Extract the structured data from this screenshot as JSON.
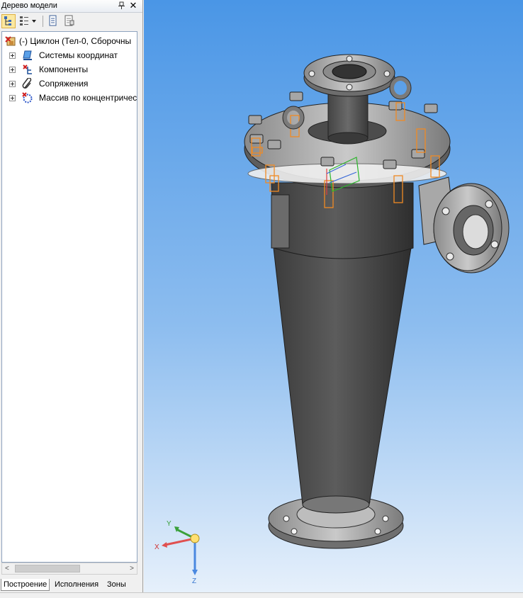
{
  "panel": {
    "title": "Дерево модели",
    "pin": "ᵾ",
    "close": "✕"
  },
  "tree": {
    "root": "(-) Циклон (Тел-0, Сборочны",
    "items": [
      {
        "label": "Системы координат",
        "icon": "coordinate-systems-icon"
      },
      {
        "label": "Компоненты",
        "icon": "components-icon"
      },
      {
        "label": "Сопряжения",
        "icon": "mates-icon"
      },
      {
        "label": "Массив по концентричес",
        "icon": "circular-array-icon"
      }
    ]
  },
  "tabs": [
    "Построение",
    "Исполнения",
    "Зоны"
  ],
  "axes": {
    "x": "X",
    "y": "Y",
    "z": "Z"
  },
  "colors": {
    "viewport_top": "#4a96e6",
    "viewport_bottom": "#e6f0fb",
    "model_body": "#4a4a4a",
    "flange": "#9a9a9a",
    "fastener": "#f08a24"
  }
}
